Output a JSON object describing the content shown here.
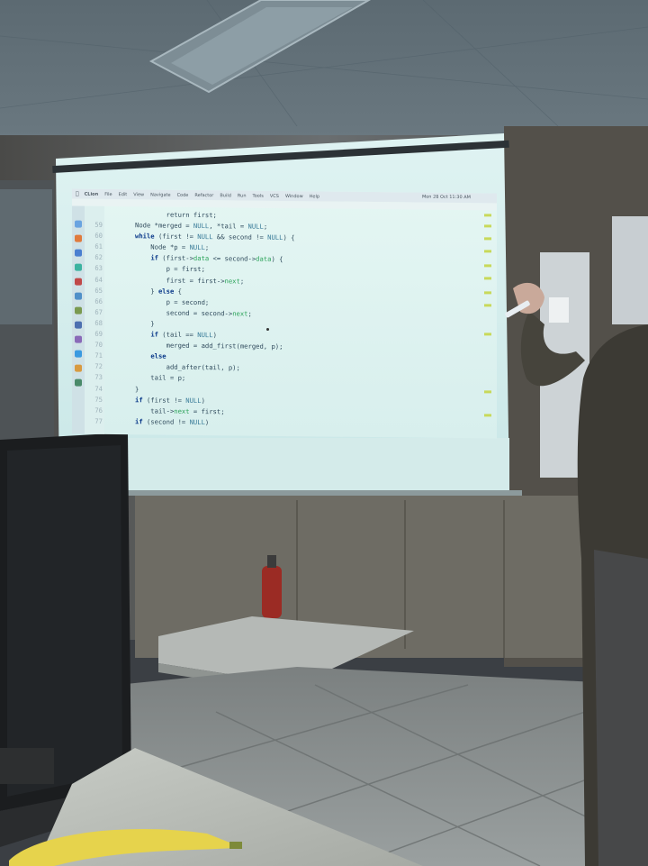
{
  "menubar": {
    "app_name": "CLion",
    "items": [
      "File",
      "Edit",
      "View",
      "Navigate",
      "Code",
      "Refactor",
      "Build",
      "Run",
      "Tools",
      "VCS",
      "Window",
      "Help"
    ],
    "status": "Mon 28 Oct 11:30 AM"
  },
  "code": {
    "lines": [
      {
        "ln": "",
        "html": "        <span>return first;</span>"
      },
      {
        "ln": "59",
        "html": "Node *merged = <span class='nl'>NULL</span>, *tail = <span class='nl'>NULL</span>;"
      },
      {
        "ln": "60",
        "html": "<span class='kw'>while</span> (first != <span class='nl'>NULL</span> && second != <span class='nl'>NULL</span>) {"
      },
      {
        "ln": "61",
        "html": "    Node *p = <span class='nl'>NULL</span>;"
      },
      {
        "ln": "62",
        "html": "    <span class='kw'>if</span> (first-><span class='mb'>data</span> <= second-><span class='mb'>data</span>) {"
      },
      {
        "ln": "63",
        "html": "        p = first;"
      },
      {
        "ln": "64",
        "html": "        first = first-><span class='mb'>next</span>;"
      },
      {
        "ln": "65",
        "html": "    } <span class='kw'>else</span> {"
      },
      {
        "ln": "66",
        "html": "        p = second;"
      },
      {
        "ln": "67",
        "html": "        second = second-><span class='mb'>next</span>;"
      },
      {
        "ln": "68",
        "html": "    }"
      },
      {
        "ln": "69",
        "html": "    <span class='kw'>if</span> (tail == <span class='nl'>NULL</span>)"
      },
      {
        "ln": "70",
        "html": "        merged = add_first(merged, p);"
      },
      {
        "ln": "71",
        "html": "    <span class='kw'>else</span>"
      },
      {
        "ln": "72",
        "html": "        add_after(tail, p);"
      },
      {
        "ln": "73",
        "html": "    tail = p;"
      },
      {
        "ln": "74",
        "html": "}"
      },
      {
        "ln": "75",
        "html": "<span class='kw'>if</span> (first != <span class='nl'>NULL</span>)"
      },
      {
        "ln": "76",
        "html": "    tail-><span class='mb'>next</span> = first;"
      },
      {
        "ln": "77",
        "html": "<span class='kw'>if</span> (second != <span class='nl'>NULL</span>)"
      }
    ]
  },
  "colors": {
    "slide_bg": "#e0f4f2",
    "keyword": "#0b3a8a",
    "member": "#2ca35a",
    "null": "#3b7d9a",
    "minimap_mark": "#c8d95a"
  }
}
